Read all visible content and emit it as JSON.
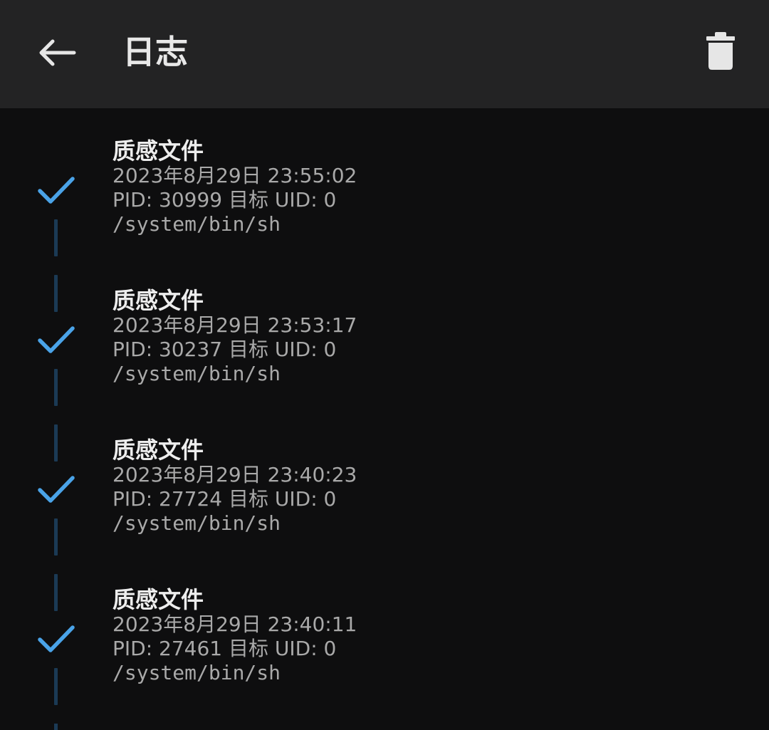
{
  "app_bar": {
    "title": "日志",
    "back_icon": "arrow-left-icon",
    "delete_icon": "trash-icon"
  },
  "colors": {
    "app_bar_bg": "#232324",
    "page_bg": "#0e0e0f",
    "check_accent": "#4aa3e8",
    "timeline_dash": "#1b3a55"
  },
  "logs": [
    {
      "title": "质感文件",
      "time": "2023年8月29日 23:55:02",
      "pid_line": "PID: 30999  目标 UID: 0",
      "command": "/system/bin/sh",
      "status_icon": "check-icon"
    },
    {
      "title": "质感文件",
      "time": "2023年8月29日 23:53:17",
      "pid_line": "PID: 30237  目标 UID: 0",
      "command": "/system/bin/sh",
      "status_icon": "check-icon"
    },
    {
      "title": "质感文件",
      "time": "2023年8月29日 23:40:23",
      "pid_line": "PID: 27724  目标 UID: 0",
      "command": "/system/bin/sh",
      "status_icon": "check-icon"
    },
    {
      "title": "质感文件",
      "time": "2023年8月29日 23:40:11",
      "pid_line": "PID: 27461  目标 UID: 0",
      "command": "/system/bin/sh",
      "status_icon": "check-icon"
    }
  ]
}
